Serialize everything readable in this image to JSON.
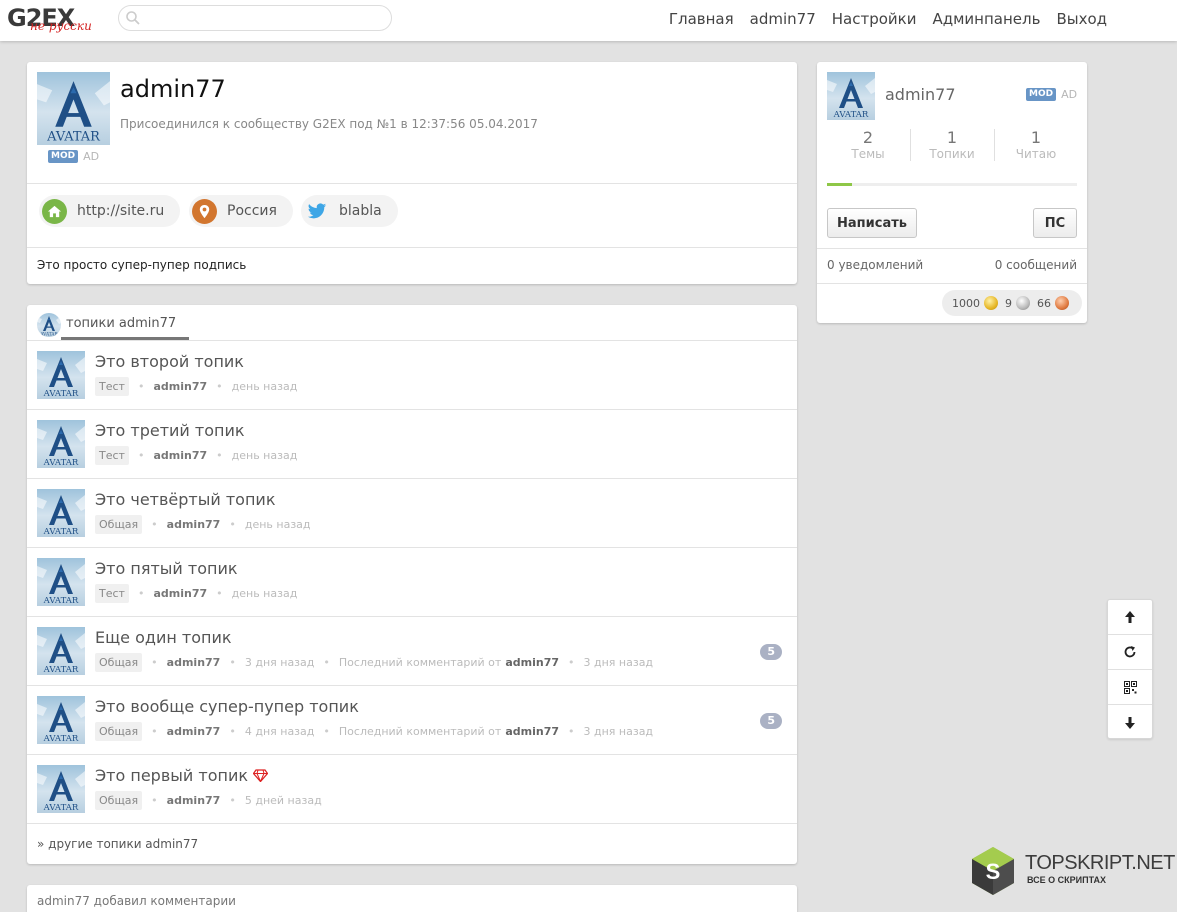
{
  "brand": {
    "logo": "G2EX",
    "logo_sub": "не русски"
  },
  "search": {
    "placeholder": "",
    "value": ""
  },
  "nav": {
    "home": "Главная",
    "user": "admin77",
    "settings": "Настройки",
    "admin": "Админпанель",
    "logout": "Выход"
  },
  "profile": {
    "username": "admin77",
    "mod_badge": "MOD",
    "ad_badge": "AD",
    "joined": "Присоединился к сообществу G2EX под №1 в 12:37:56 05.04.2017",
    "links": [
      {
        "icon": "home-icon",
        "text": "http://site.ru"
      },
      {
        "icon": "location-icon",
        "text": "Россия"
      },
      {
        "icon": "twitter-icon",
        "text": "blabla"
      }
    ],
    "signature": "Это просто супер-пупер подпись"
  },
  "topics": {
    "header": "топики admin77",
    "items": [
      {
        "title": "Это второй топик",
        "node": "Тест",
        "author": "admin77",
        "time": "день назад"
      },
      {
        "title": "Это третий топик",
        "node": "Тест",
        "author": "admin77",
        "time": "день назад"
      },
      {
        "title": "Это четвёртый топик",
        "node": "Общая",
        "author": "admin77",
        "time": "день назад"
      },
      {
        "title": "Это пятый топик",
        "node": "Тест",
        "author": "admin77",
        "time": "день назад"
      },
      {
        "title": "Еще один топик",
        "node": "Общая",
        "author": "admin77",
        "time": "3 дня назад",
        "last_label": "Последний комментарий от",
        "last_author": "admin77",
        "last_time": "3 дня назад",
        "replies": "5"
      },
      {
        "title": "Это вообще супер-пупер топик",
        "node": "Общая",
        "author": "admin77",
        "time": "4 дня назад",
        "last_label": "Последний комментарий от",
        "last_author": "admin77",
        "last_time": "3 дня назад",
        "replies": "5"
      },
      {
        "title": "Это первый топик",
        "node": "Общая",
        "author": "admin77",
        "time": "5 дней назад",
        "gem": true
      }
    ],
    "more": "» другие топики admin77"
  },
  "comments_card": {
    "header": "admin77 добавил комментарии"
  },
  "sidebar": {
    "username": "admin77",
    "mod_badge": "MOD",
    "ad_badge": "AD",
    "stats": [
      {
        "value": "2",
        "label": "Темы"
      },
      {
        "value": "1",
        "label": "Топики"
      },
      {
        "value": "1",
        "label": "Читаю"
      }
    ],
    "progress": 0.1,
    "write_button": "Написать",
    "pm_button": "ПС",
    "notifications": "0 уведомлений",
    "messages": "0 сообщений",
    "coins": {
      "gold": "1000",
      "silver": "9",
      "bronze": "66"
    }
  },
  "watermark": {
    "title": "TOPSKRIPT.NET",
    "subtitle": "ВСЕ О СКРИПТАХ",
    "letter": "S"
  },
  "colors": {
    "mod_badge": "#6895c6",
    "progress": "#8ec747",
    "reply_count": "#aab1c4",
    "home_icon": "#7ab648",
    "location_icon": "#d2762f",
    "twitter_icon": "#3ea6e6"
  }
}
